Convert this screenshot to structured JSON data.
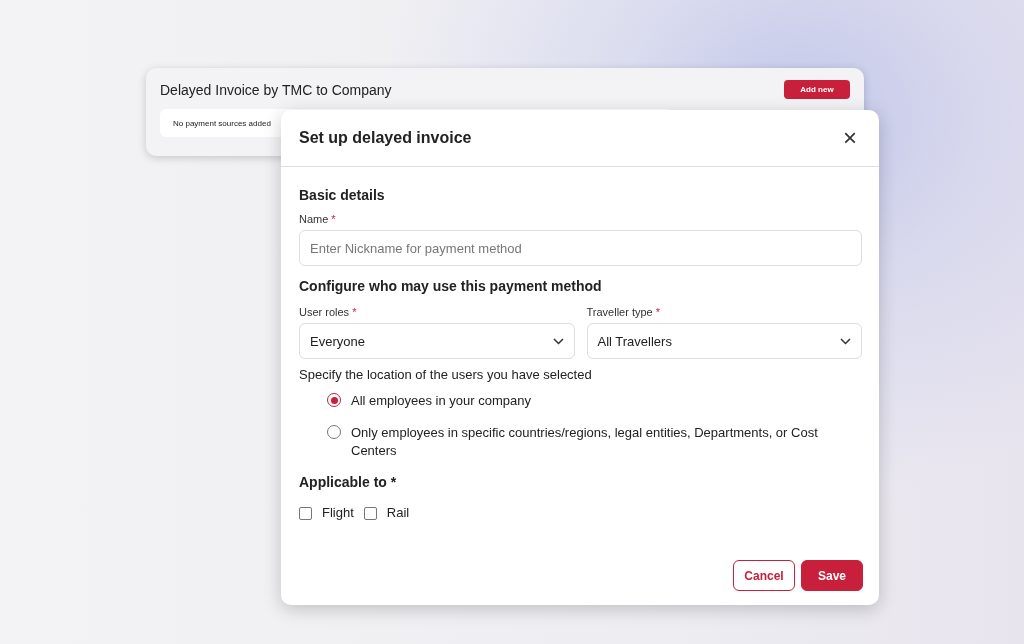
{
  "background_card": {
    "title": "Delayed Invoice by TMC to Company",
    "add_button": "Add new",
    "empty_message": "No payment sources added"
  },
  "dialog": {
    "title": "Set up delayed invoice",
    "close": "×",
    "basic_heading": "Basic details",
    "name_field": {
      "label": "Name",
      "required_mark": "*",
      "placeholder": "Enter Nickname for payment method"
    },
    "configure_heading": "Configure who may use this payment method",
    "selects": [
      {
        "label": "User roles",
        "required_mark": "*",
        "value": "Everyone"
      },
      {
        "label": "Traveller type",
        "required_mark": "*",
        "value": "All Travellers"
      }
    ],
    "location_prompt": "Specify the location of the users you have selected",
    "location_options": [
      {
        "label": "All employees in your company",
        "selected": true
      },
      {
        "label": "Only employees in specific countries/regions, legal entities, Departments, or Cost Centers",
        "selected": false
      }
    ],
    "applicable_heading": "Applicable to *",
    "applicable_options": [
      {
        "label": "Flight",
        "checked": false
      },
      {
        "label": "Rail",
        "checked": false
      }
    ],
    "buttons": [
      {
        "kind": "secondary",
        "label": "Cancel"
      },
      {
        "kind": "primary",
        "label": "Save"
      }
    ]
  }
}
